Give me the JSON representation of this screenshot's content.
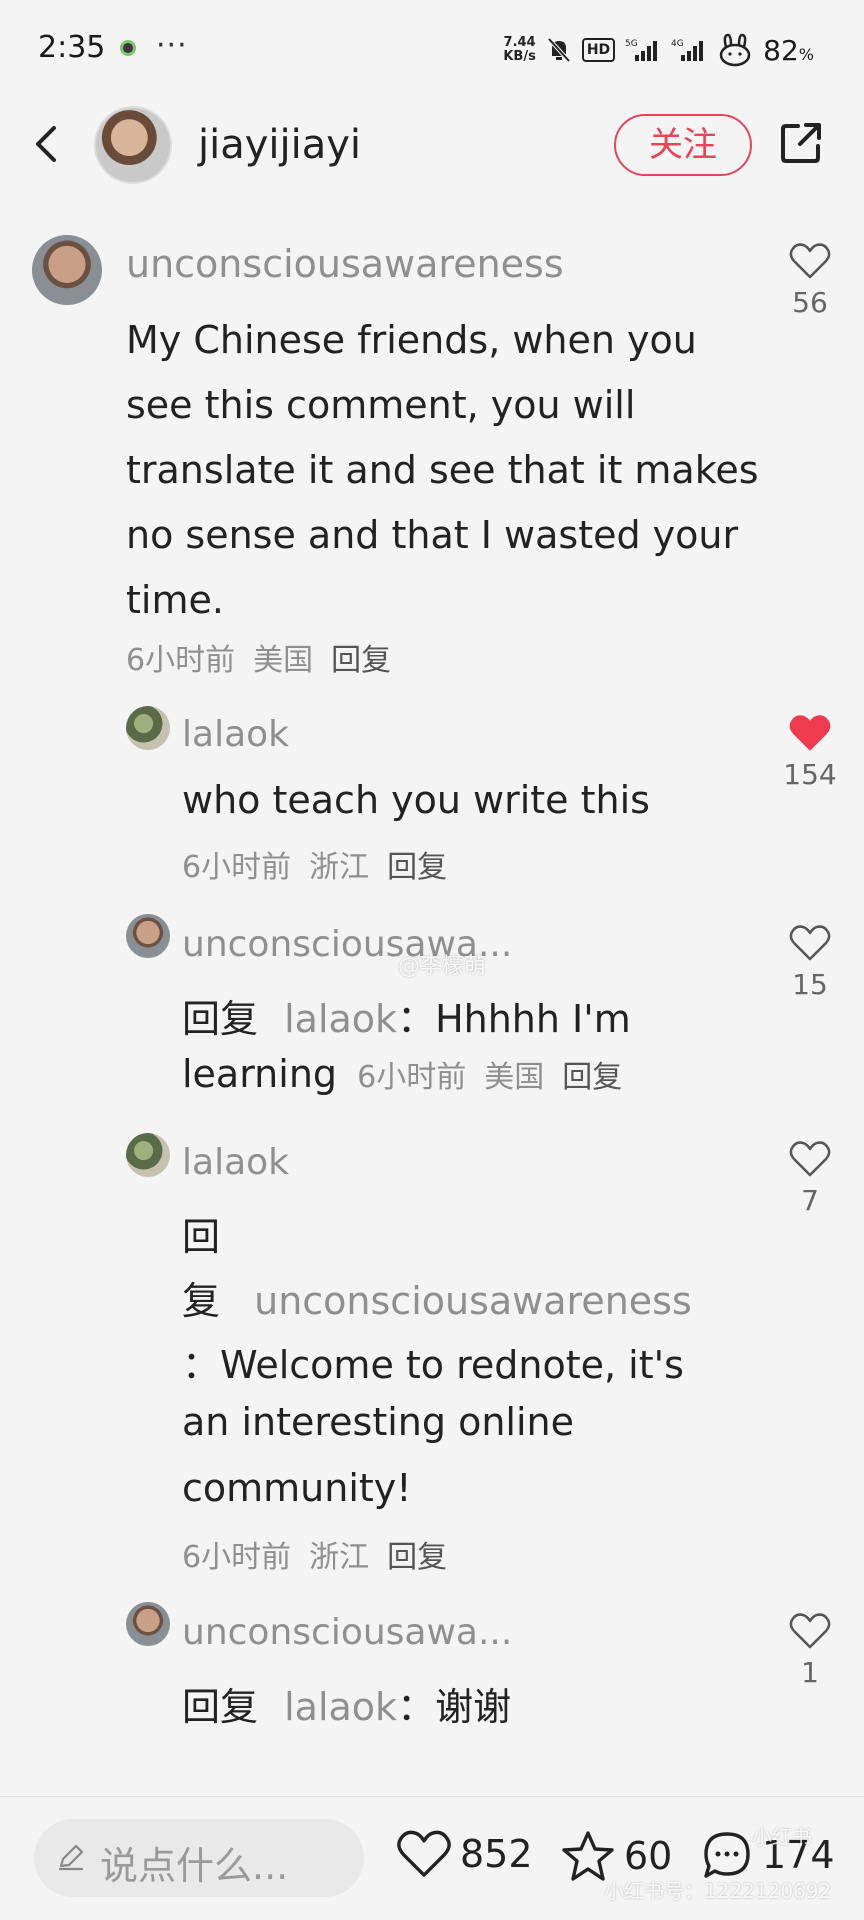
{
  "status_bar": {
    "time": "2:35",
    "more": "···",
    "net_speed_value": "7.44",
    "net_speed_unit": "KB/s",
    "hd_badge": "HD",
    "signal_1": "5G",
    "signal_2": "4G",
    "battery": "82",
    "battery_unit": "%"
  },
  "header": {
    "author_name": "jiayijiayi",
    "follow_label": "关注"
  },
  "comments": [
    {
      "user": "unconsciousawareness",
      "text": "My Chinese friends, when you see this comment, you will translate it and see that it makes no sense and that I wasted your time.",
      "time": "6小时前",
      "location": "美国",
      "reply_label": "回复",
      "likes": "56",
      "liked": false
    },
    {
      "user": "lalaok",
      "text": "who teach you write this",
      "time": "6小时前",
      "location": "浙江",
      "reply_label": "回复",
      "likes": "154",
      "liked": true
    },
    {
      "user": "unconsciousawa...",
      "reply_prefix": "回复",
      "reply_to": "lalaok",
      "text_line1": "：Hhhhh I'm",
      "text_line2": "learning",
      "time": "6小时前",
      "location": "美国",
      "reply_label": "回复",
      "likes": "15",
      "liked": false
    },
    {
      "user": "lalaok",
      "reply_prefix_1": "回",
      "reply_prefix_2": "复",
      "reply_to": "unconsciousawareness",
      "text_line1": "：Welcome to rednote, it's",
      "text_line2": "an interesting online",
      "text_line3": "community!",
      "time": "6小时前",
      "location": "浙江",
      "reply_label": "回复",
      "likes": "7",
      "liked": false
    },
    {
      "user": "unconsciousawa...",
      "reply_prefix": "回复",
      "reply_to": "lalaok",
      "text": "：谢谢",
      "likes": "1",
      "liked": false
    }
  ],
  "bottom_bar": {
    "input_placeholder": "说点什么...",
    "likes": "852",
    "stars": "60",
    "comments": "174"
  },
  "watermarks": {
    "weibo": "@李檬萌",
    "xhs_logo": "小红书",
    "xhs_id": "小红书号：1222120692"
  },
  "colors": {
    "accent": "#e6455a",
    "liked_heart": "#ef3b4f",
    "secondary_text": "#8f8f8f",
    "background": "#f4f4f4"
  }
}
